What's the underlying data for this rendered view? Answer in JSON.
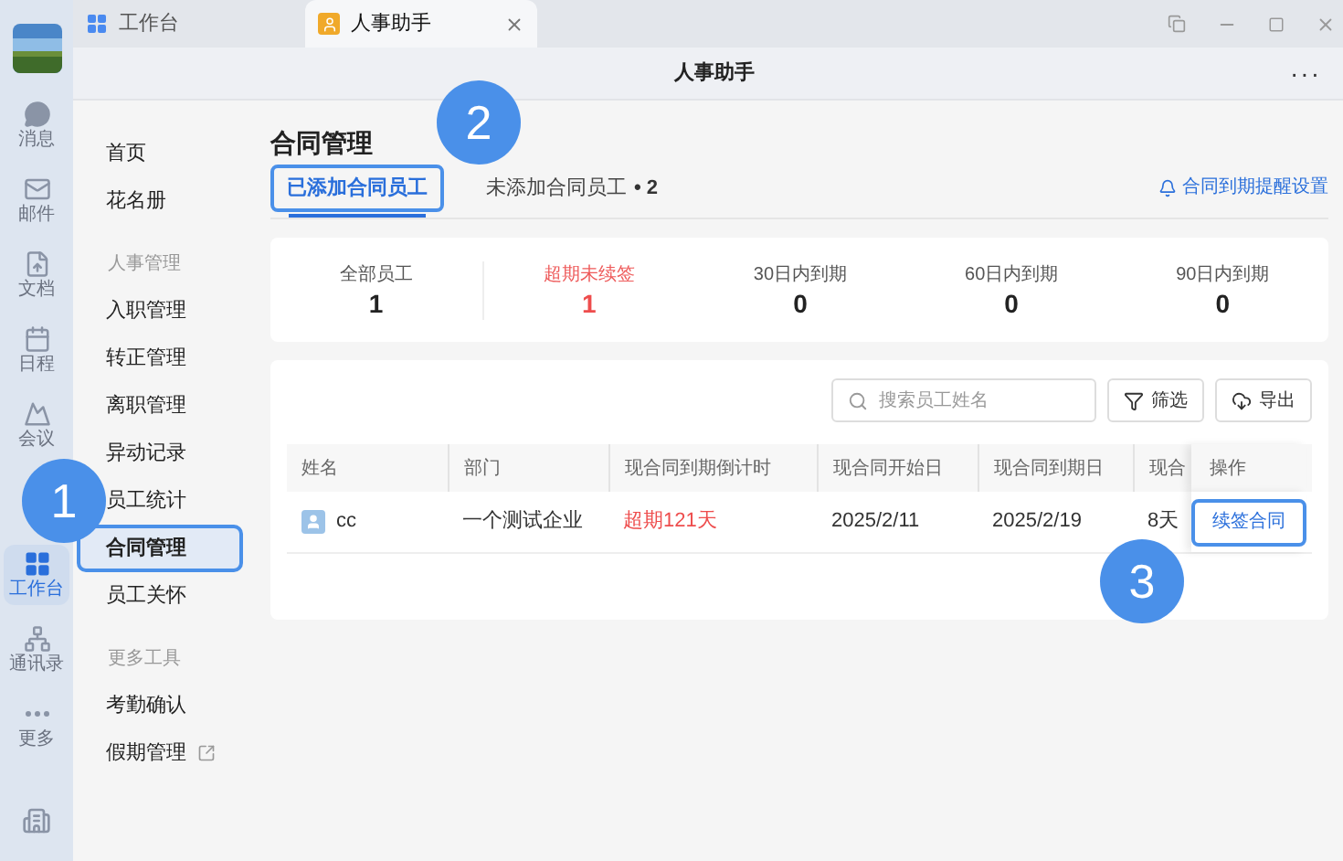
{
  "rail": {
    "items": [
      {
        "label": "消息",
        "kind": "message",
        "selected": false
      },
      {
        "label": "邮件",
        "kind": "mail",
        "selected": false
      },
      {
        "label": "文档",
        "kind": "doc",
        "selected": false
      },
      {
        "label": "日程",
        "kind": "calendar",
        "selected": false
      },
      {
        "label": "会议",
        "kind": "meeting",
        "selected": false
      },
      {
        "label": "工作台",
        "kind": "grid",
        "selected": true
      },
      {
        "label": "通讯录",
        "kind": "org",
        "selected": false
      },
      {
        "label": "更多",
        "kind": "more",
        "selected": false
      }
    ]
  },
  "window_tabs": [
    {
      "label": "工作台",
      "kind": "grid",
      "selected": false,
      "closable": false
    },
    {
      "label": "人事助手",
      "kind": "person",
      "selected": true,
      "closable": true
    }
  ],
  "title_bar": {
    "title": "人事助手",
    "menu": "···"
  },
  "nav": {
    "sections": [
      {
        "items": [
          {
            "label": "首页",
            "selected": false
          },
          {
            "label": "花名册",
            "selected": false
          }
        ]
      },
      {
        "header": "人事管理",
        "items": [
          {
            "label": "入职管理",
            "selected": false
          },
          {
            "label": "转正管理",
            "selected": false
          },
          {
            "label": "离职管理",
            "selected": false
          },
          {
            "label": "异动记录",
            "selected": false
          },
          {
            "label": "员工统计",
            "selected": false
          },
          {
            "label": "合同管理",
            "selected": true,
            "highlighted": true,
            "callout": "1"
          },
          {
            "label": "员工关怀",
            "selected": false
          }
        ]
      },
      {
        "header": "更多工具",
        "items": [
          {
            "label": "考勤确认",
            "selected": false
          },
          {
            "label": "假期管理",
            "selected": false,
            "external": true
          }
        ]
      }
    ]
  },
  "page": {
    "title": "合同管理",
    "tabs": [
      {
        "label": "已添加合同员工",
        "selected": true,
        "highlighted": true,
        "callout": "2"
      },
      {
        "label": "未添加合同员工",
        "count": "• 2",
        "selected": false
      }
    ],
    "reminder_link": "合同到期提醒设置",
    "stats": [
      {
        "label": "全部员工",
        "value": "1",
        "alert": false
      },
      {
        "label": "超期未续签",
        "value": "1",
        "alert": true
      },
      {
        "label": "30日内到期",
        "value": "0",
        "alert": false
      },
      {
        "label": "60日内到期",
        "value": "0",
        "alert": false
      },
      {
        "label": "90日内到期",
        "value": "0",
        "alert": false
      }
    ],
    "search": {
      "placeholder": "搜索员工姓名"
    },
    "buttons": [
      {
        "label": "筛选",
        "kind": "filter"
      },
      {
        "label": "导出",
        "kind": "export"
      }
    ],
    "table": {
      "columns": [
        "姓名",
        "部门",
        "现合同到期倒计时",
        "现合同开始日",
        "现合同到期日",
        "现合",
        "操作"
      ],
      "rows": [
        {
          "name": "cc",
          "department": "一个测试企业",
          "countdown": "超期121天",
          "overdue": true,
          "start": "2025/2/11",
          "end": "2025/2/19",
          "column_6": "8天",
          "action": {
            "label": "续签合同",
            "highlighted": true,
            "callout": "3"
          }
        }
      ]
    }
  }
}
